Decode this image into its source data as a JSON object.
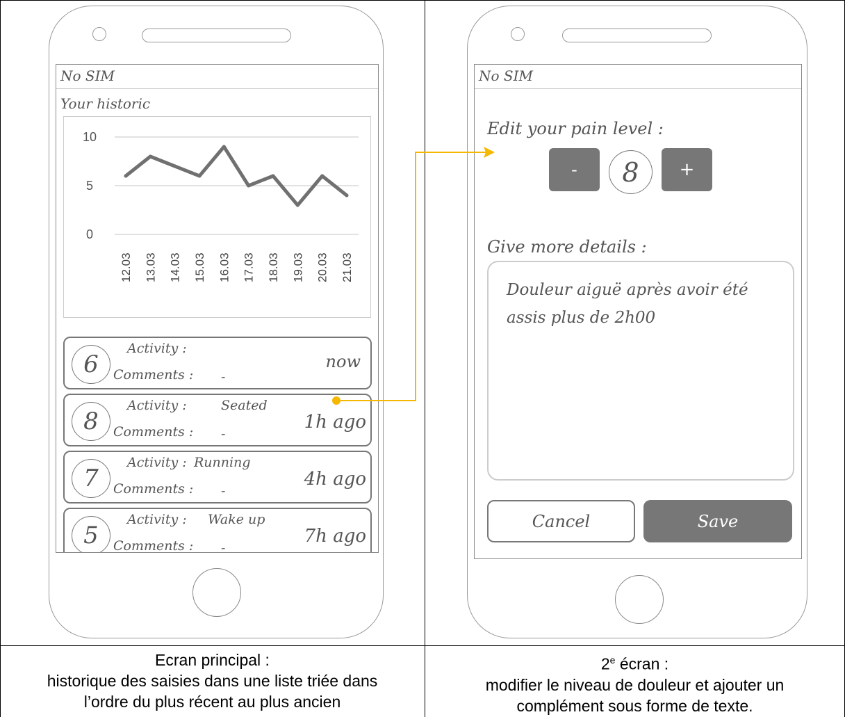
{
  "left_phone": {
    "status": "No SIM",
    "title": "Your historic",
    "entries": [
      {
        "level": "6",
        "activity_label": "Activity :",
        "activity": "",
        "comments_label": "Comments :",
        "comments": "-",
        "time": "now"
      },
      {
        "level": "8",
        "activity_label": "Activity :",
        "activity": "Seated",
        "comments_label": "Comments :",
        "comments": "-",
        "time": "1h ago"
      },
      {
        "level": "7",
        "activity_label": "Activity :",
        "activity": "Running",
        "comments_label": "Comments :",
        "comments": "-",
        "time": "4h ago"
      },
      {
        "level": "5",
        "activity_label": "Activity :",
        "activity": "Wake up",
        "comments_label": "Comments :",
        "comments": "-",
        "time": "7h ago"
      }
    ]
  },
  "chart_data": {
    "type": "line",
    "categories": [
      "12.03",
      "13.03",
      "14.03",
      "15.03",
      "16.03",
      "17.03",
      "18.03",
      "19.03",
      "20.03",
      "21.03"
    ],
    "values": [
      6,
      8,
      7,
      6,
      9,
      5,
      6,
      3,
      6,
      4
    ],
    "yticks": [
      "0",
      "5",
      "10"
    ],
    "ylim": [
      0,
      10
    ],
    "grid": true,
    "line_color": "#707070"
  },
  "right_phone": {
    "status": "No SIM",
    "pain_label": "Edit your pain level :",
    "minus_label": "-",
    "pain_value": "8",
    "plus_label": "+",
    "details_label": "Give more details :",
    "details_text": "Douleur aiguë après avoir été assis plus de 2h00",
    "cancel_label": "Cancel",
    "save_label": "Save"
  },
  "connector_color": "#f5b800",
  "captions": {
    "left_line1": "Ecran principal :",
    "left_line2": "historique des saisies dans une liste triée dans",
    "left_line3": "l’ordre du plus récent au plus ancien",
    "right_line1_a": "2",
    "right_line1_sup": "e",
    "right_line1_b": " écran :",
    "right_line2": "modifier le niveau de douleur et ajouter un",
    "right_line3": "complément sous forme de texte."
  }
}
